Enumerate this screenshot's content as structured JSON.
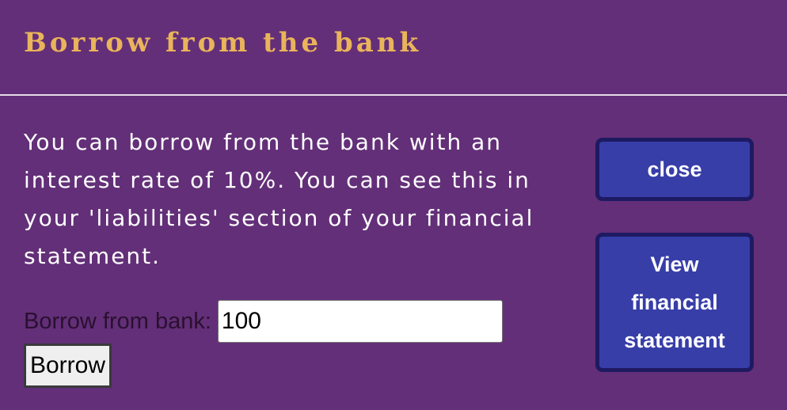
{
  "dialog": {
    "title": "Borrow from the bank",
    "message": "You can borrow from the bank with an interest rate of 10%. You can see this in your 'liabilities' section of your financial statement.",
    "borrow_label": "Borrow from bank:",
    "borrow_input_value": "100",
    "borrow_button_label": "Borrow",
    "close_button_label": "close",
    "view_statement_label": "View financial statement"
  },
  "colors": {
    "background": "#632f78",
    "title": "#e9b45a",
    "button": "#373ea8",
    "button_border": "#1e1a62"
  }
}
